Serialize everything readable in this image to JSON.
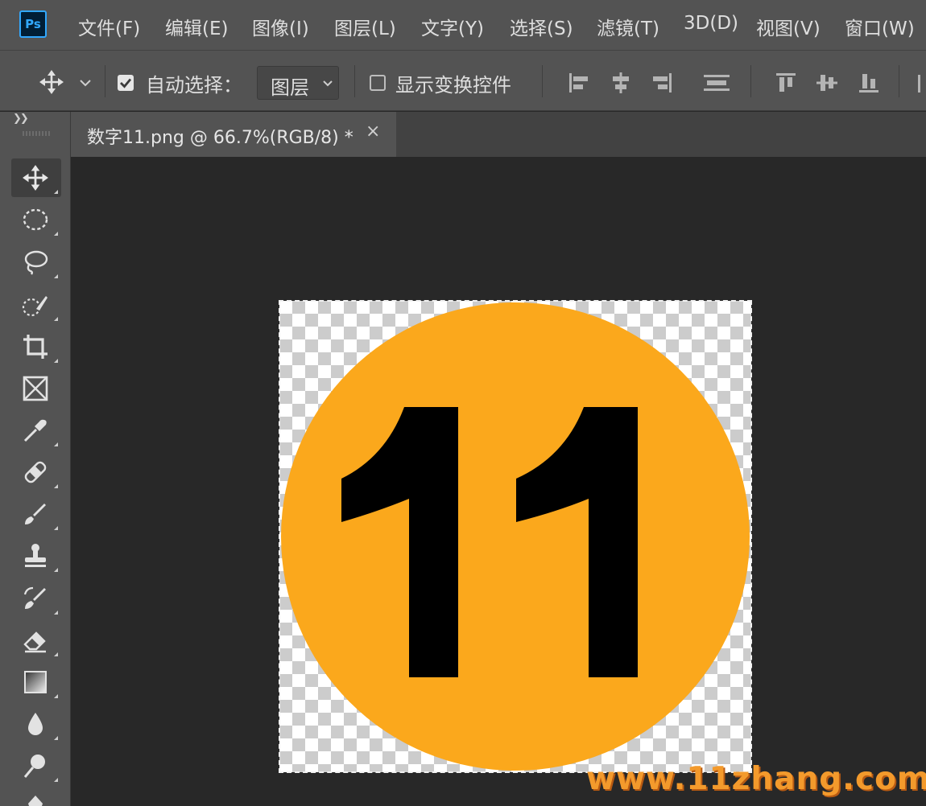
{
  "app": {
    "logo_text": "Ps",
    "accent_color": "#31a8ff"
  },
  "menu": {
    "items": [
      {
        "label": "文件(F)"
      },
      {
        "label": "编辑(E)"
      },
      {
        "label": "图像(I)"
      },
      {
        "label": "图层(L)"
      },
      {
        "label": "文字(Y)"
      },
      {
        "label": "选择(S)"
      },
      {
        "label": "滤镜(T)"
      },
      {
        "label": "3D(D)"
      },
      {
        "label": "视图(V)"
      },
      {
        "label": "窗口(W)"
      }
    ]
  },
  "options": {
    "tool_icon": "move-icon",
    "auto_select": {
      "label": "自动选择：",
      "checked": true
    },
    "auto_select_target": "图层",
    "transform_controls": {
      "label": "显示变换控件",
      "checked": false
    },
    "align_icons": [
      "align-left-icon",
      "align-horizontal-center-icon",
      "align-right-icon",
      "distribute-icon",
      "align-top-icon",
      "align-vertical-center-icon",
      "align-bottom-icon"
    ]
  },
  "tools": [
    "move-tool",
    "marquee-tool",
    "lasso-tool",
    "quick-selection-tool",
    "crop-tool",
    "frame-tool",
    "eyedropper-tool",
    "healing-brush-tool",
    "brush-tool",
    "clone-stamp-tool",
    "history-brush-tool",
    "eraser-tool",
    "gradient-tool",
    "blur-tool",
    "dodge-tool",
    "pen-tool"
  ],
  "document": {
    "tab_title": "数字11.png @ 66.7%(RGB/8) *",
    "close_symbol": "×",
    "image_text": "11",
    "circle_color": "#fba81c",
    "digit_color": "#000000"
  },
  "watermark": "www.11zhang.com"
}
